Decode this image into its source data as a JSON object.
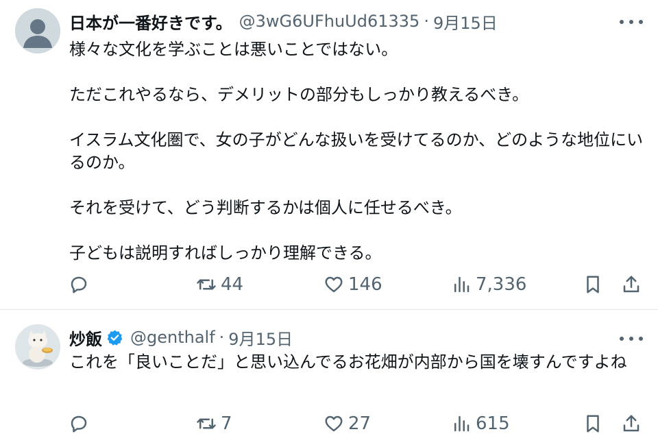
{
  "tweets": [
    {
      "display_name": "日本が一番好きです。",
      "handle": "@3wG6UFhuUd61335",
      "separator": "·",
      "date": "9月15日",
      "verified": false,
      "avatar_icon": "default-avatar-icon",
      "paragraphs": [
        "様々な文化を学ぶことは悪いことではない。",
        "ただこれやるなら、デメリットの部分もしっかり教えるべき。",
        "イスラム文化圏で、女の子がどんな扱いを受けてるのか、どのような地位にいるのか。",
        "それを受けて、どう判断するかは個人に任せるべき。",
        "子どもは説明すればしっかり理解できる。"
      ],
      "actions": {
        "replies": "",
        "reposts": "44",
        "likes": "146",
        "views": "7,336"
      }
    },
    {
      "display_name": "炒飯",
      "handle": "@genthalf",
      "separator": "·",
      "date": "9月15日",
      "verified": true,
      "avatar_icon": "cat-figure-avatar-icon",
      "paragraphs": [
        "これを「良いことだ」と思い込んでるお花畑が内部から国を壊すんですよね"
      ],
      "actions": {
        "replies": "",
        "reposts": "7",
        "likes": "27",
        "views": "615"
      }
    }
  ],
  "colors": {
    "text": "#0f1419",
    "secondary": "#536471",
    "verified_badge": "#1d9bf0",
    "divider": "#e6e9ec"
  }
}
